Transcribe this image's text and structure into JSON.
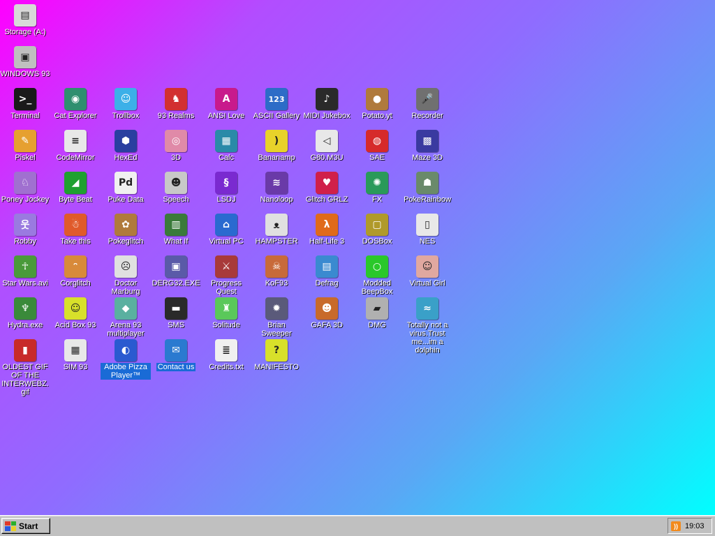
{
  "desktop": {
    "icons": [
      {
        "label": "Storage (A:)",
        "glyph": "▤",
        "color": "#d8d8d8",
        "name": "storage-drive-icon"
      },
      {
        "label": "WINDOWS 93",
        "glyph": "▣",
        "color": "#bfbfbf",
        "name": "computer-icon"
      },
      {
        "label": "Terminal",
        "glyph": ">_",
        "color": "#1a1a1a",
        "name": "terminal-icon"
      },
      {
        "label": "Cat Explorer",
        "glyph": "◉",
        "color": "#2f8f6f",
        "name": "cat-explorer-icon"
      },
      {
        "label": "Trollbox",
        "glyph": "☺",
        "color": "#3cb0e8",
        "name": "trollbox-icon"
      },
      {
        "label": "93 Realms",
        "glyph": "♞",
        "color": "#d23030",
        "name": "realms-icon"
      },
      {
        "label": "ANSI Love",
        "glyph": "A",
        "color": "#c81a8c",
        "name": "ansi-love-icon"
      },
      {
        "label": "ASCII Gallery",
        "glyph": "123",
        "color": "#2d6cc7",
        "name": "ascii-gallery-icon"
      },
      {
        "label": "MIDI Jukebox",
        "glyph": "♪",
        "color": "#2a2a2a",
        "name": "midi-jukebox-icon"
      },
      {
        "label": "Potato.yt",
        "glyph": "●",
        "color": "#b07a3c",
        "name": "potato-icon"
      },
      {
        "label": "Recorder",
        "glyph": "🎤",
        "color": "#707070",
        "name": "microphone-icon"
      },
      {
        "label": "Piskel",
        "glyph": "✎",
        "color": "#e6a030",
        "name": "palette-icon"
      },
      {
        "label": "CodeMirror",
        "glyph": "≡",
        "color": "#e8e8e8",
        "name": "codemirror-icon"
      },
      {
        "label": "HexEd",
        "glyph": "⬢",
        "color": "#2a3fa0",
        "name": "hexed-icon"
      },
      {
        "label": "3D",
        "glyph": "◎",
        "color": "#e08aa8",
        "name": "teapot-icon"
      },
      {
        "label": "Calc",
        "glyph": "▦",
        "color": "#2a8aa8",
        "name": "calculator-icon"
      },
      {
        "label": "Bananamp",
        "glyph": ")",
        "color": "#e8d22a",
        "name": "banana-icon"
      },
      {
        "label": "G80.M3U",
        "glyph": "◁",
        "color": "#e8e8e8",
        "name": "playlist-icon"
      },
      {
        "label": "SAE",
        "glyph": "◍",
        "color": "#d62a2a",
        "name": "amiga-ball-icon"
      },
      {
        "label": "Maze 3D",
        "glyph": "▩",
        "color": "#3a3aa0",
        "name": "maze-icon"
      },
      {
        "label": "Poney Jockey",
        "glyph": "♘",
        "color": "#a070d0",
        "name": "pony-icon"
      },
      {
        "label": "Byte Beat",
        "glyph": "◢",
        "color": "#1fa02f",
        "name": "byte-beat-icon"
      },
      {
        "label": "Puke Data",
        "glyph": "Pd",
        "color": "#f0f0f0",
        "name": "puke-data-icon"
      },
      {
        "label": "Speech",
        "glyph": "☻",
        "color": "#c8c8c8",
        "name": "speech-face-icon"
      },
      {
        "label": "LSDJ",
        "glyph": "§",
        "color": "#7a2ad0",
        "name": "lsdj-icon"
      },
      {
        "label": "Nanoloop",
        "glyph": "≋",
        "color": "#6a3aa8",
        "name": "nanoloop-icon"
      },
      {
        "label": "Glitch GRLZ",
        "glyph": "♥",
        "color": "#d0204a",
        "name": "lips-icon"
      },
      {
        "label": "FX",
        "glyph": "✺",
        "color": "#2a9a5a",
        "name": "fx-atom-icon"
      },
      {
        "label": "PokeRainbow",
        "glyph": "☗",
        "color": "#6a8a6a",
        "name": "pokerainbow-icon"
      },
      {
        "label": "Robby",
        "glyph": "웃",
        "color": "#9a7ae0",
        "name": "robby-stickman-icon"
      },
      {
        "label": "Take this",
        "glyph": "☃",
        "color": "#e05a2a",
        "name": "take-this-icon"
      },
      {
        "label": "Pokeglitch",
        "glyph": "✿",
        "color": "#b07a3c",
        "name": "pokeglitch-icon"
      },
      {
        "label": "What If",
        "glyph": "▥",
        "color": "#3a7a3a",
        "name": "what-if-icon"
      },
      {
        "label": "Virtual PC",
        "glyph": "⌂",
        "color": "#2a6ad0",
        "name": "virtual-pc-icon"
      },
      {
        "label": "HAMPSTER",
        "glyph": "ᴥ",
        "color": "#e0e0e0",
        "name": "hampster-icon"
      },
      {
        "label": "Half-Life 3",
        "glyph": "λ",
        "color": "#e06a1a",
        "name": "half-life-icon"
      },
      {
        "label": "DOSBox",
        "glyph": "▢",
        "color": "#b09a2a",
        "name": "dosbox-icon"
      },
      {
        "label": "NES",
        "glyph": "▯",
        "color": "#e8e8e8",
        "name": "nes-console-icon"
      },
      {
        "label": "Star Wars.avi",
        "glyph": "☥",
        "color": "#4a9a3a",
        "name": "yoda-icon"
      },
      {
        "label": "Corglitch",
        "glyph": "ᵔ",
        "color": "#d88a3a",
        "name": "corgi-icon"
      },
      {
        "label": "Doctor Marburg",
        "glyph": "☹",
        "color": "#e0e0e0",
        "name": "doctor-icon"
      },
      {
        "label": "DERG32.EXE",
        "glyph": "▣",
        "color": "#5a5aa8",
        "name": "derg-exe-icon"
      },
      {
        "label": "Progress Quest",
        "glyph": "⚔",
        "color": "#a83a3a",
        "name": "progress-quest-icon"
      },
      {
        "label": "KoF93",
        "glyph": "☠",
        "color": "#c86a3a",
        "name": "kof-fighter-icon"
      },
      {
        "label": "Defrag",
        "glyph": "▤",
        "color": "#3a8ad0",
        "name": "defrag-icon"
      },
      {
        "label": "Modded BeepBox",
        "glyph": "○",
        "color": "#2ac82a",
        "name": "beepbox-icon"
      },
      {
        "label": "Virtual Girl",
        "glyph": "☺",
        "color": "#e0a8a0",
        "name": "virtual-girl-icon"
      },
      {
        "label": "Hydra.exe",
        "glyph": "♆",
        "color": "#3a8a3a",
        "name": "hydra-icon"
      },
      {
        "label": "Acid Box 93",
        "glyph": "☺",
        "color": "#d8e02a",
        "name": "acid-smiley-icon"
      },
      {
        "label": "Arena 93 multiplayer",
        "glyph": "◆",
        "color": "#5ab0a0",
        "name": "arena-cube-icon"
      },
      {
        "label": "SMS",
        "glyph": "▬",
        "color": "#2a2a2a",
        "name": "sms-console-icon"
      },
      {
        "label": "Solitude",
        "glyph": "♜",
        "color": "#5ac85a",
        "name": "solitude-icon"
      },
      {
        "label": "Brian Sweeper",
        "glyph": "✹",
        "color": "#5a5a7a",
        "name": "mine-icon"
      },
      {
        "label": "GAFA 3D",
        "glyph": "☻",
        "color": "#c86a2a",
        "name": "gafa-face-icon"
      },
      {
        "label": "DMG",
        "glyph": "▰",
        "color": "#b0b0b0",
        "name": "dmg-icon"
      },
      {
        "label": "Totally not a virus.Trust me...im a dolphin",
        "glyph": "≈",
        "color": "#3aa0c8",
        "name": "dolphin-icon"
      },
      {
        "label": "OLDEST GIF OF THE INTERWEBZ.gif",
        "glyph": "▮",
        "color": "#c82a2a",
        "name": "gif-file-icon"
      },
      {
        "label": "SIM 93",
        "glyph": "▦",
        "color": "#e8e8e8",
        "name": "sim-icon"
      },
      {
        "label": "Adobe Pizza Player™",
        "glyph": "◐",
        "color": "#2a5ad0",
        "name": "pizza-player-icon"
      },
      {
        "label": "Contact us",
        "glyph": "✉",
        "color": "#2a7ad0",
        "name": "contact-icon"
      },
      {
        "label": "Credits.txt",
        "glyph": "≣",
        "color": "#f0f0f0",
        "name": "text-file-icon"
      },
      {
        "label": "MANIFESTO",
        "glyph": "?",
        "color": "#d8e02a",
        "name": "manifesto-question-icon"
      }
    ]
  },
  "taskbar": {
    "start_label": "Start",
    "clock": "19:03",
    "tray_icon": "rss-icon"
  },
  "colors": {
    "taskbar": "#c0c0c0",
    "selection": "#1a6bd6"
  }
}
